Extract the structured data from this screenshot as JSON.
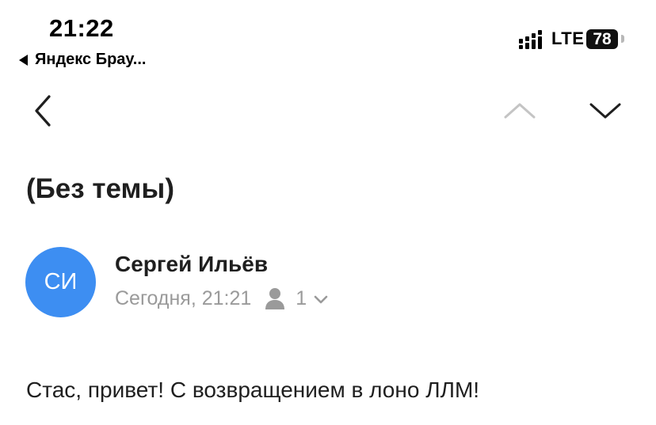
{
  "status_bar": {
    "time": "21:22",
    "back_app": "Яндекс Брау...",
    "network": "LTE",
    "battery": "78"
  },
  "nav": {
    "back_icon": "chevron-left-icon",
    "prev_icon": "chevron-up-icon",
    "next_icon": "chevron-down-icon"
  },
  "email": {
    "subject": "(Без темы)",
    "avatar_initials": "СИ",
    "avatar_color": "#3d8ef2",
    "sender": "Сергей Ильёв",
    "date": "Сегодня, 21:21",
    "recipients_count": "1",
    "body": "Стас, привет! С возвращением в лоно ЛЛМ!"
  }
}
